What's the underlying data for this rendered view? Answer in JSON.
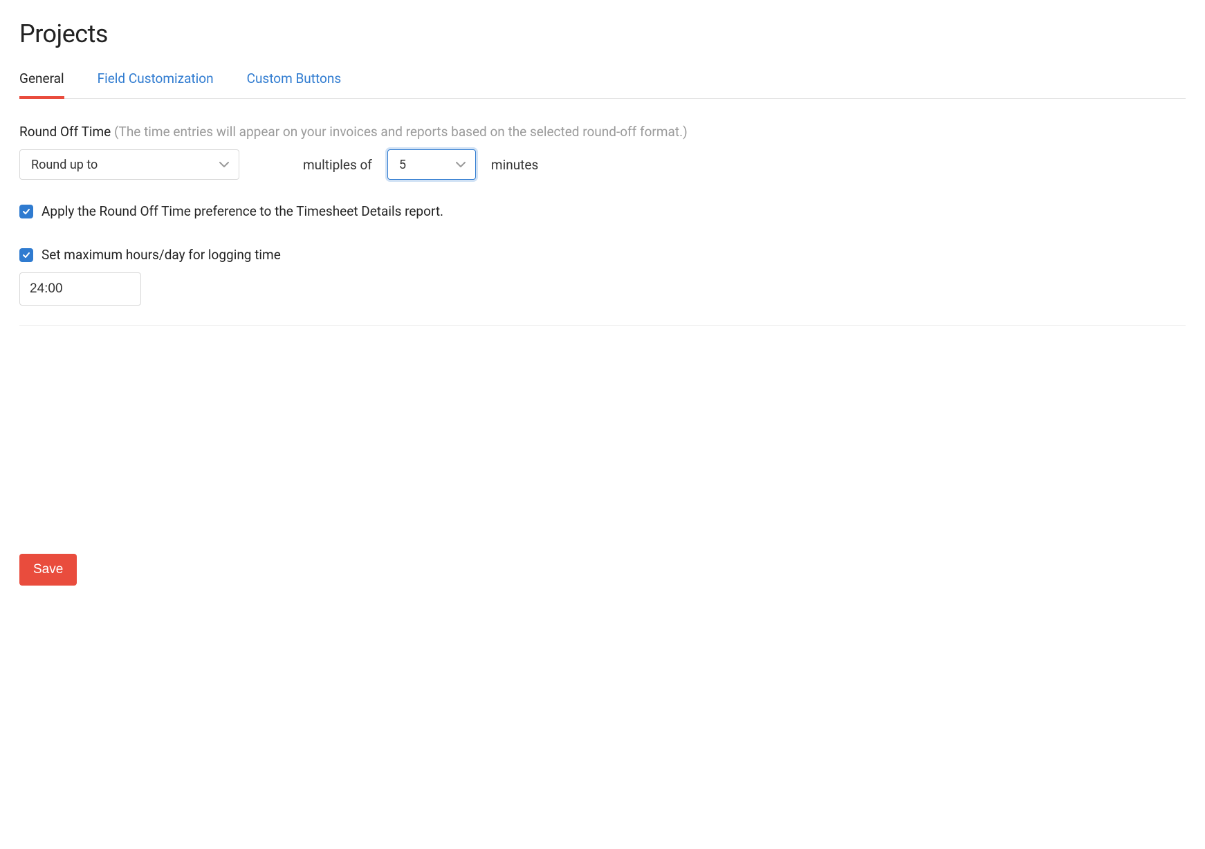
{
  "page": {
    "title": "Projects"
  },
  "tabs": {
    "general": "General",
    "field_customization": "Field Customization",
    "custom_buttons": "Custom Buttons"
  },
  "round_off": {
    "label": "Round Off Time",
    "hint": "(The time entries will appear on your invoices and reports based on the selected round-off format.)",
    "direction_value": "Round up to",
    "multiples_label": "multiples of",
    "multiples_value": "5",
    "unit_label": "minutes"
  },
  "apply_checkbox": {
    "label": "Apply the Round Off Time preference to the Timesheet Details report."
  },
  "max_hours_checkbox": {
    "label": "Set maximum hours/day for logging time",
    "value": "24:00"
  },
  "buttons": {
    "save": "Save"
  }
}
